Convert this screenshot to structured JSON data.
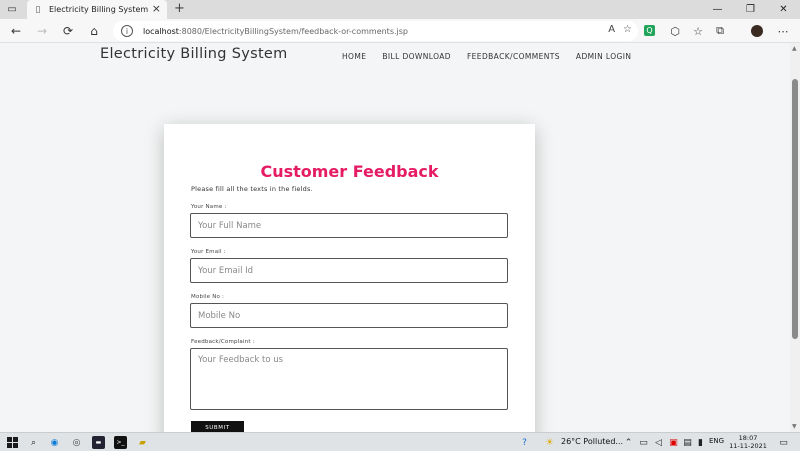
{
  "browser": {
    "tab_title": "Electricity Billing System",
    "tab_close": "×",
    "new_tab": "+",
    "url_host": "localhost",
    "url_path": ":8080/ElectricityBillingSystem/feedback-or-comments.jsp",
    "nav_back": "←",
    "nav_forward": "→",
    "nav_refresh": "⟳",
    "nav_home": "⌂",
    "window_minimize": "—",
    "window_restore": "❐",
    "window_close": "✕"
  },
  "site": {
    "title": "Electricity Billing System",
    "nav": [
      "HOME",
      "BILL DOWNLOAD",
      "FEEDBACK/COMMENTS",
      "ADMIN LOGIN"
    ]
  },
  "form": {
    "heading": "Customer Feedback",
    "subheading": "Please fill all the texts in the fields.",
    "name_label": "Your Name :",
    "name_placeholder": "Your Full Name",
    "email_label": "Your Email :",
    "email_placeholder": "Your Email Id",
    "mobile_label": "Mobile No :",
    "mobile_placeholder": "Mobile No",
    "feedback_label": "Feedback/Complaint :",
    "feedback_placeholder": "Your Feedback to us",
    "submit_label": "SUBMIT"
  },
  "taskbar": {
    "weather": "26°C  Polluted...",
    "language": "ENG",
    "time": "18:07",
    "date": "11-11-2021"
  },
  "colors": {
    "heading": "#e51c64",
    "submit_bg": "#111111",
    "page_bg": "#f3f5f6"
  }
}
